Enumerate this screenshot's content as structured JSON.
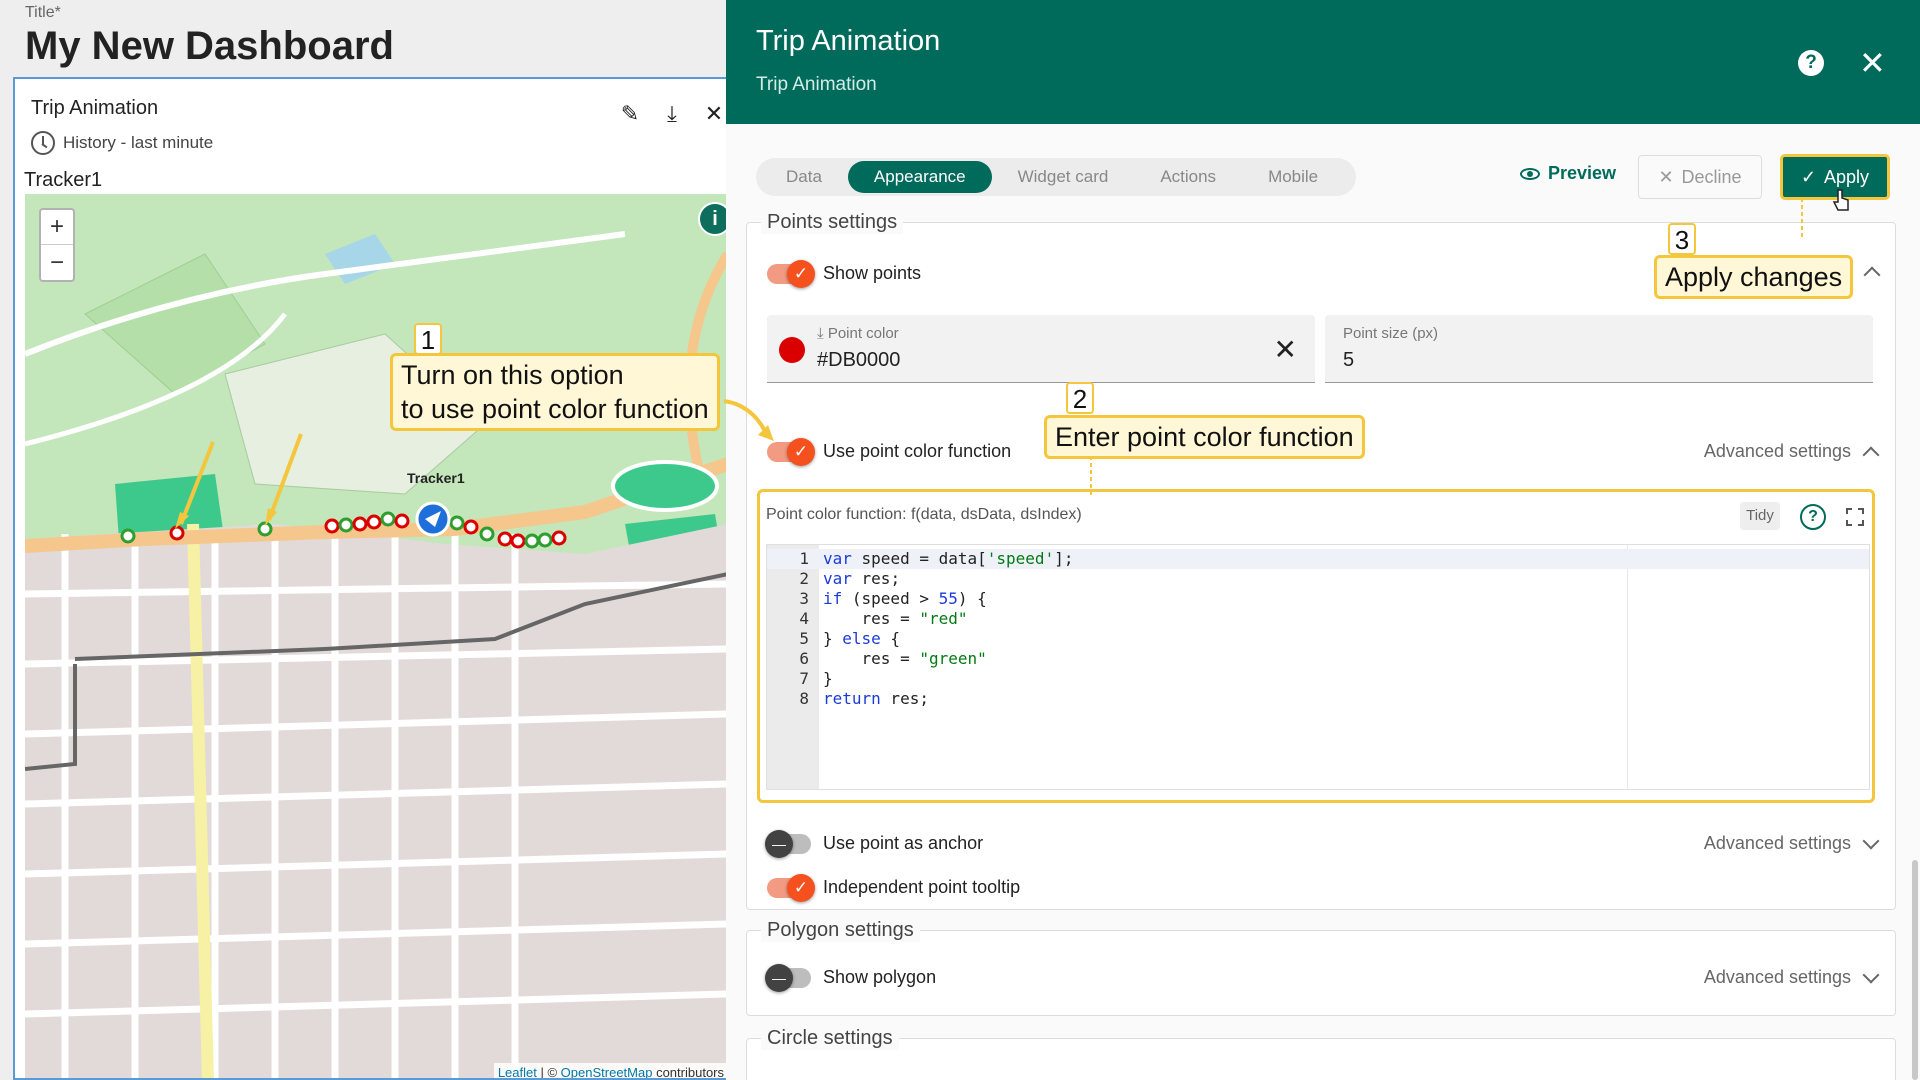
{
  "dashboard": {
    "title_label": "Title*",
    "title": "My New Dashboard",
    "widget": {
      "title": "Trip Animation",
      "subtitle": "History - last minute",
      "tracker_label": "Tracker1",
      "map_tracker_label": "Tracker1",
      "attribution_leaflet": "Leaflet",
      "attribution_osm": "OpenStreetMap",
      "attribution_rest": "contributors"
    }
  },
  "panel": {
    "title": "Trip Animation",
    "subtitle": "Trip Animation",
    "tabs": [
      {
        "label": "Data"
      },
      {
        "label": "Appearance"
      },
      {
        "label": "Widget card"
      },
      {
        "label": "Actions"
      },
      {
        "label": "Mobile"
      }
    ],
    "preview_label": "Preview",
    "decline_label": "Decline",
    "apply_label": "Apply",
    "points": {
      "title": "Points settings",
      "show_points": "Show points",
      "point_color_label": "Point color",
      "point_color_value": "#DB0000",
      "point_size_label": "Point size (px)",
      "point_size_value": "5",
      "use_color_function": "Use point color function",
      "advanced_settings": "Advanced settings",
      "function_label": "Point color function: f(data, dsData, dsIndex)",
      "tidy_label": "Tidy",
      "use_anchor": "Use point as anchor",
      "advanced_settings_2": "Advanced settings",
      "independent_tooltip": "Independent point tooltip"
    },
    "polygon": {
      "title": "Polygon settings",
      "show_polygon": "Show polygon",
      "advanced_settings": "Advanced settings"
    },
    "circle": {
      "title": "Circle settings"
    }
  },
  "code_lines": [
    {
      "n": "1",
      "text": "var speed = data['speed'];"
    },
    {
      "n": "2",
      "text": "var res;"
    },
    {
      "n": "3",
      "text": "if (speed > 55) {"
    },
    {
      "n": "4",
      "text": "    res = \"red\""
    },
    {
      "n": "5",
      "text": "} else {"
    },
    {
      "n": "6",
      "text": "    res = \"green\""
    },
    {
      "n": "7",
      "text": "}"
    },
    {
      "n": "8",
      "text": "return res;"
    }
  ],
  "callouts": {
    "c1_num": "1",
    "c1_line1": "Turn on this option",
    "c1_line2": "to use point color function",
    "c2_num": "2",
    "c2_text": "Enter point color function",
    "c3_num": "3",
    "c3_text": "Apply changes"
  },
  "colors": {
    "header": "#006a5b",
    "accent_toggle": "#f4511e",
    "point_red": "#DB0000",
    "point_green": "#2e9e2e",
    "callout_border": "#f4c63d"
  }
}
